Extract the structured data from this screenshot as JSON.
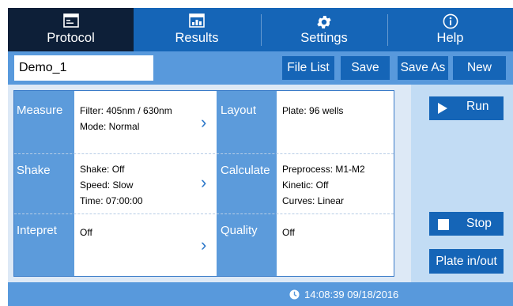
{
  "nav": {
    "tabs": [
      {
        "label": "Protocol",
        "icon": "window-icon",
        "active": true
      },
      {
        "label": "Results",
        "icon": "chart-icon",
        "active": false
      },
      {
        "label": "Settings",
        "icon": "gear-icon",
        "active": false
      },
      {
        "label": "Help",
        "icon": "info-icon",
        "active": false
      }
    ]
  },
  "toolbar": {
    "protocol_name": "Demo_1",
    "file_list_label": "File List",
    "save_label": "Save",
    "save_as_label": "Save As",
    "new_label": "New"
  },
  "sections": {
    "measure": {
      "label": "Measure",
      "lines": [
        "Filter:  405nm / 630nm",
        "Mode:   Normal"
      ]
    },
    "shake": {
      "label": "Shake",
      "lines": [
        "Shake:  Off",
        "Speed:  Slow",
        "Time:  07:00:00"
      ]
    },
    "interpret": {
      "label": "Intepret",
      "lines": [
        "Off"
      ]
    },
    "layout": {
      "label": "Layout",
      "lines": [
        "Plate:  96 wells"
      ]
    },
    "calculate": {
      "label": "Calculate",
      "lines": [
        "Preprocess: M1-M2",
        "Kinetic: Off",
        "Curves: Linear"
      ]
    },
    "quality": {
      "label": "Quality",
      "lines": [
        "Off"
      ]
    }
  },
  "side": {
    "run_label": "Run",
    "stop_label": "Stop",
    "plate_label": "Plate in/out"
  },
  "status": {
    "datetime": "14:08:39 09/18/2016"
  },
  "colors": {
    "nav_bg": "#1565b7",
    "nav_active": "#0d1f38",
    "toolbar_bg": "#5899dc",
    "button_bg": "#1565b7",
    "category_bg": "#5c9bdb",
    "side_bg": "#c2dcf4"
  }
}
